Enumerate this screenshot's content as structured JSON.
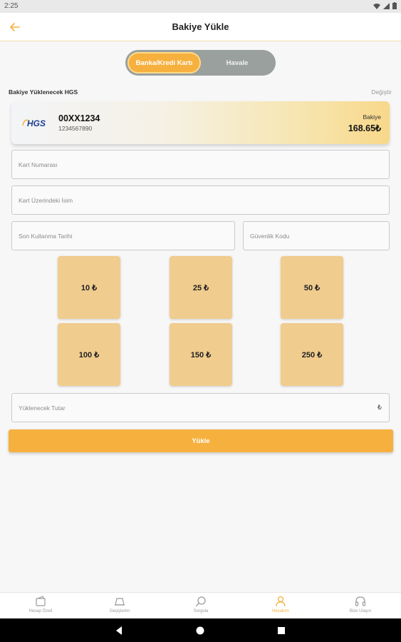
{
  "status": {
    "time": "2:25"
  },
  "header": {
    "title": "Bakiye Yükle"
  },
  "segment": {
    "active_label": "Banka/Kredi Kartı",
    "inactive_label": "Havale"
  },
  "hgs": {
    "section_label": "Bakiye Yüklenecek HGS",
    "change_label": "Değiştir",
    "logo_text": "HGS",
    "plate": "00XX1234",
    "serial": "1234567890",
    "balance_label": "Bakiye",
    "balance_value": "168.65₺"
  },
  "form": {
    "card_number_placeholder": "Kart Numarası",
    "card_name_placeholder": "Kart Üzerindeki İsim",
    "expiry_placeholder": "Son Kullanma Tarihi",
    "cvv_placeholder": "Güvenlik Kodu",
    "amount_placeholder": "Yüklenecek Tutar",
    "amount_suffix": "₺"
  },
  "amounts": [
    "10 ₺",
    "25 ₺",
    "50 ₺",
    "100 ₺",
    "150 ₺",
    "250 ₺"
  ],
  "load_button": {
    "label": "Yükle"
  },
  "tabs": [
    {
      "label": "Hesap Özeti",
      "icon": "wallet-icon"
    },
    {
      "label": "Geçişlerim",
      "icon": "toll-gate-icon"
    },
    {
      "label": "Sorgula",
      "icon": "search-icon"
    },
    {
      "label": "Hesabım",
      "icon": "user-icon"
    },
    {
      "label": "Bize Ulaşın",
      "icon": "headset-icon"
    }
  ],
  "active_tab": "Hesabım",
  "colors": {
    "accent": "#f6b03e",
    "tile": "#f0cc8e",
    "segment_bg": "#9aa09e"
  }
}
